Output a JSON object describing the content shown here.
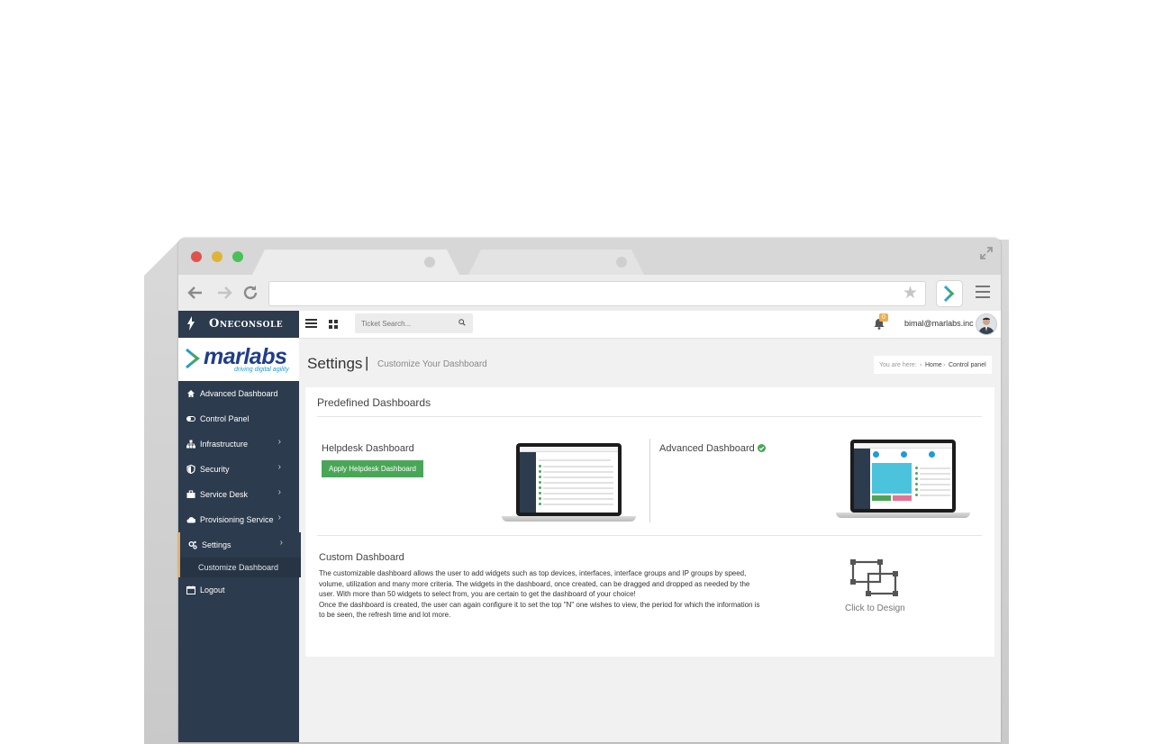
{
  "app": {
    "brand": "Oneconsole",
    "search": {
      "placeholder": "Ticket Search..."
    },
    "notifications": {
      "count": "0"
    },
    "user": {
      "email": "bimal@marlabs.inc"
    }
  },
  "sidebar": {
    "logo": {
      "name": "marlabs",
      "tagline": "driving digital agility"
    },
    "items": [
      {
        "label": "Advanced Dashboard",
        "icon": "home-icon"
      },
      {
        "label": "Control Panel",
        "icon": "toggle-icon"
      },
      {
        "label": "Infrastructure",
        "icon": "sitemap-icon"
      },
      {
        "label": "Security",
        "icon": "shield-icon"
      },
      {
        "label": "Service Desk",
        "icon": "briefcase-icon"
      },
      {
        "label": "Provisioning Service",
        "icon": "cloud-icon"
      },
      {
        "label": "Settings",
        "icon": "cogs-icon"
      },
      {
        "label": "Logout",
        "icon": "calendar-icon"
      }
    ],
    "submenu": {
      "label": "Customize Dashboard"
    }
  },
  "page": {
    "title": "Settings",
    "separator": "|",
    "subtitle": "Customize Your Dashboard",
    "breadcrumb": {
      "prefix": "You are here:",
      "home": "Home",
      "current": "Control panel"
    }
  },
  "panel": {
    "title": "Predefined Dashboards",
    "helpdesk": {
      "title": "Helpdesk Dashboard",
      "button": "Apply Helpdesk Dashboard"
    },
    "advanced": {
      "title": "Advanced Dashboard"
    },
    "custom": {
      "title": "Custom Dashboard",
      "description": "The customizable dashboard allows the user to add widgets such as top devices, interfaces, interface groups and IP groups by speed, volume, utilization and many more criteria. The widgets in the dashboard, once created, can be dragged and dropped as needed by the user. With more than 50 widgets to select from, you are certain to get the dashboard of your choice!",
      "description2": "Once the dashboard is created, the user can again configure it to set the top \"N\" one wishes to view, the period for which the information is to be seen, the refresh time and lot more.",
      "design_label": "Click to Design"
    }
  },
  "colors": {
    "sidebar": "#2c3b4d",
    "accent": "#f0ad4e",
    "success": "#4aa657",
    "brand_blue": "#1f3d8a"
  }
}
